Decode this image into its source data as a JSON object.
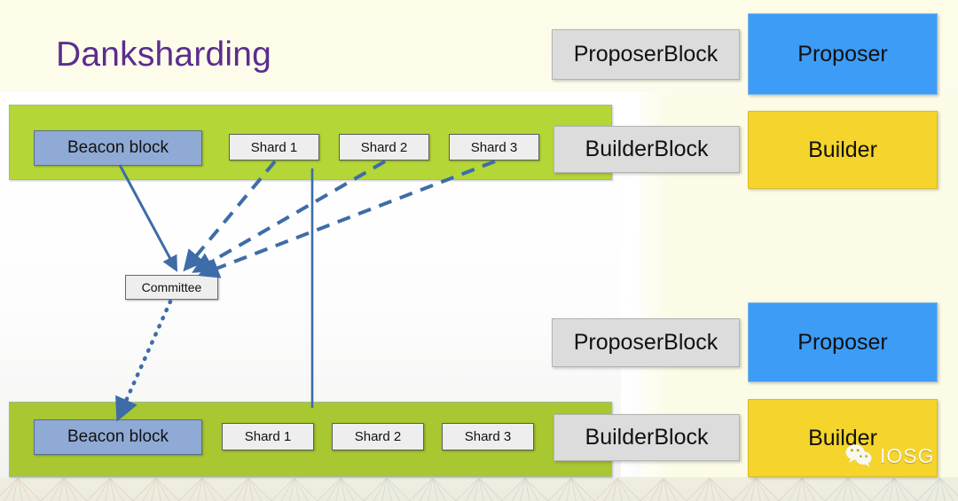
{
  "slide": {
    "title": "Danksharding",
    "title_color": "#5b2d8e",
    "background_color": "#fcfbe6",
    "panel_color": "#ffffff"
  },
  "colors": {
    "green_bar": "#b4d636",
    "green_bar_lower": "#a8c731",
    "beacon_block": "#8faad4",
    "shard_box": "#eeeeee",
    "gray_block": "#dcdcdc",
    "proposer": "#3d9cf5",
    "builder": "#f5d42c",
    "connector": "#3e6ca8"
  },
  "rows": [
    {
      "id": "upper",
      "beacon_label": "Beacon block",
      "shards": [
        "Shard 1",
        "Shard 2",
        "Shard 3"
      ],
      "builder_block_label": "BuilderBlock",
      "proposer_block_label": "ProposerBlock",
      "proposer_label": "Proposer",
      "builder_label": "Builder"
    },
    {
      "id": "lower",
      "beacon_label": "Beacon block",
      "shards": [
        "Shard 1",
        "Shard 2",
        "Shard 3"
      ],
      "builder_block_label": "BuilderBlock",
      "proposer_block_label": "ProposerBlock",
      "proposer_label": "Proposer",
      "builder_label": "Builder"
    }
  ],
  "committee": {
    "label": "Committee"
  },
  "connectors": [
    {
      "from": "upper-beacon-block",
      "to": "committee",
      "style": "solid",
      "arrow": true
    },
    {
      "from": "upper-shard-1",
      "to": "committee",
      "style": "dashed",
      "arrow": true
    },
    {
      "from": "upper-shard-2",
      "to": "committee",
      "style": "dashed",
      "arrow": true
    },
    {
      "from": "upper-shard-3",
      "to": "committee",
      "style": "dashed",
      "arrow": true
    },
    {
      "from": "committee",
      "to": "lower-beacon-block",
      "style": "dotted",
      "arrow": true
    },
    {
      "from": "upper-green-bar",
      "to": "lower-green-bar",
      "style": "solid",
      "arrow": false
    }
  ],
  "watermark": {
    "icon": "wechat-icon",
    "text": "IOSG"
  }
}
